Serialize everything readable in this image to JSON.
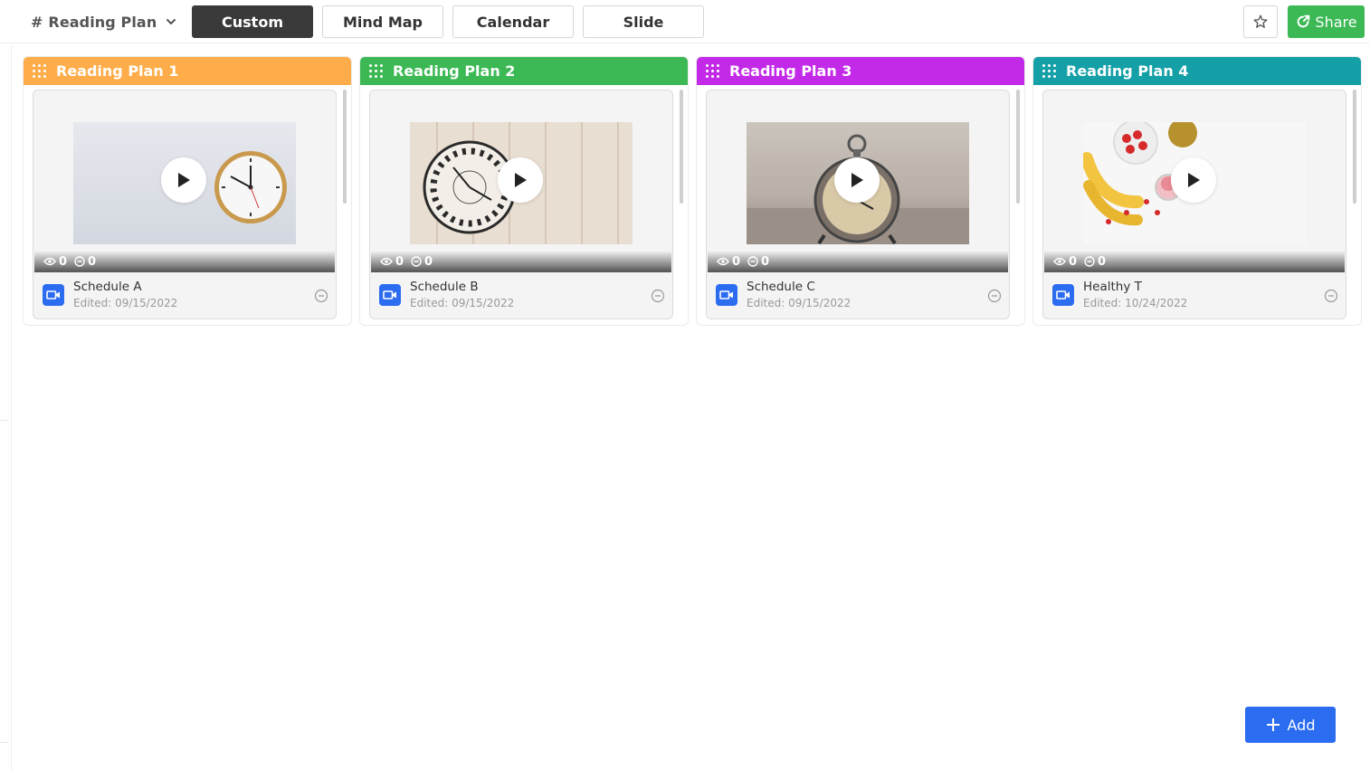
{
  "header": {
    "title_hash": "#",
    "title": "Reading Plan",
    "tabs": [
      {
        "label": "Custom",
        "active": true
      },
      {
        "label": "Mind Map",
        "active": false
      },
      {
        "label": "Calendar",
        "active": false
      },
      {
        "label": "Slide",
        "active": false
      }
    ],
    "share_label": "Share"
  },
  "columns": [
    {
      "title": "Reading Plan 1",
      "color": "#ffad4a",
      "card": {
        "title": "Schedule A",
        "edited": "Edited: 09/15/2022",
        "views": "0",
        "comments": "0"
      }
    },
    {
      "title": "Reading Plan 2",
      "color": "#3cb955",
      "card": {
        "title": "Schedule B",
        "edited": "Edited: 09/15/2022",
        "views": "0",
        "comments": "0"
      }
    },
    {
      "title": "Reading Plan 3",
      "color": "#c32ae8",
      "card": {
        "title": "Schedule C",
        "edited": "Edited: 09/15/2022",
        "views": "0",
        "comments": "0"
      }
    },
    {
      "title": "Reading Plan 4",
      "color": "#14a0a6",
      "card": {
        "title": "Healthy T",
        "edited": "Edited: 10/24/2022",
        "views": "0",
        "comments": "0"
      }
    }
  ],
  "add_label": "Add",
  "colors": {
    "accent_blue": "#2b6cf0",
    "share_green": "#3cb955",
    "active_tab": "#3a3a3a"
  },
  "icons": [
    "hash-icon",
    "chevron-down-icon",
    "star-icon",
    "share-icon",
    "grip-icon",
    "play-icon",
    "eye-icon",
    "comment-icon",
    "video-icon",
    "remove-icon",
    "plus-icon"
  ]
}
